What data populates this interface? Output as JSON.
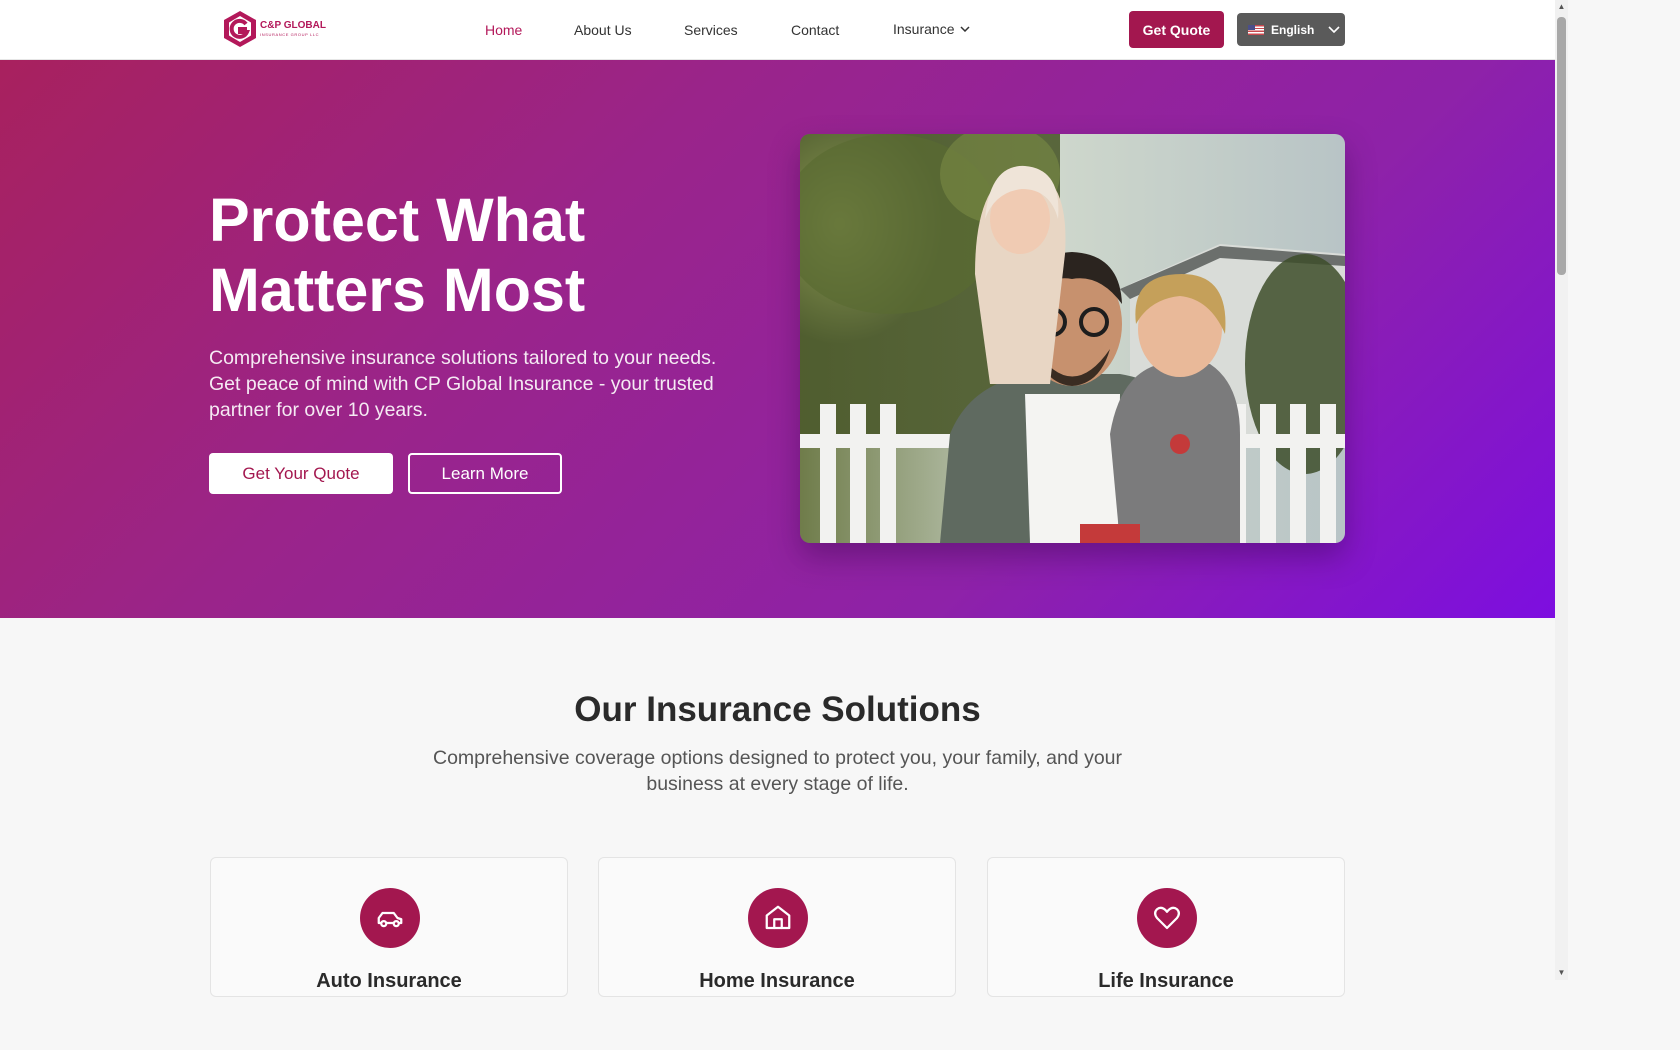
{
  "brand": {
    "name": "C&P GLOBAL",
    "tagline": "INSURANCE GROUP LLC",
    "color": "#a3174f"
  },
  "nav": {
    "items": [
      "Home",
      "About Us",
      "Services",
      "Contact",
      "Insurance"
    ],
    "active": "Home",
    "get_quote": "Get Quote",
    "language": "English"
  },
  "hero": {
    "title": "Protect What Matters Most",
    "description": "Comprehensive insurance solutions tailored to your needs. Get peace of mind with CP Global Insurance - your trusted partner for over 10 years.",
    "primary_cta": "Get Your Quote",
    "secondary_cta": "Learn More",
    "image_subject": "family-photo"
  },
  "solutions": {
    "title": "Our Insurance Solutions",
    "subtitle": "Comprehensive coverage options designed to protect you, your family, and your business at every stage of life.",
    "cards": [
      {
        "title": "Auto Insurance",
        "icon": "car-icon"
      },
      {
        "title": "Home Insurance",
        "icon": "home-icon"
      },
      {
        "title": "Life Insurance",
        "icon": "heart-icon"
      }
    ]
  }
}
